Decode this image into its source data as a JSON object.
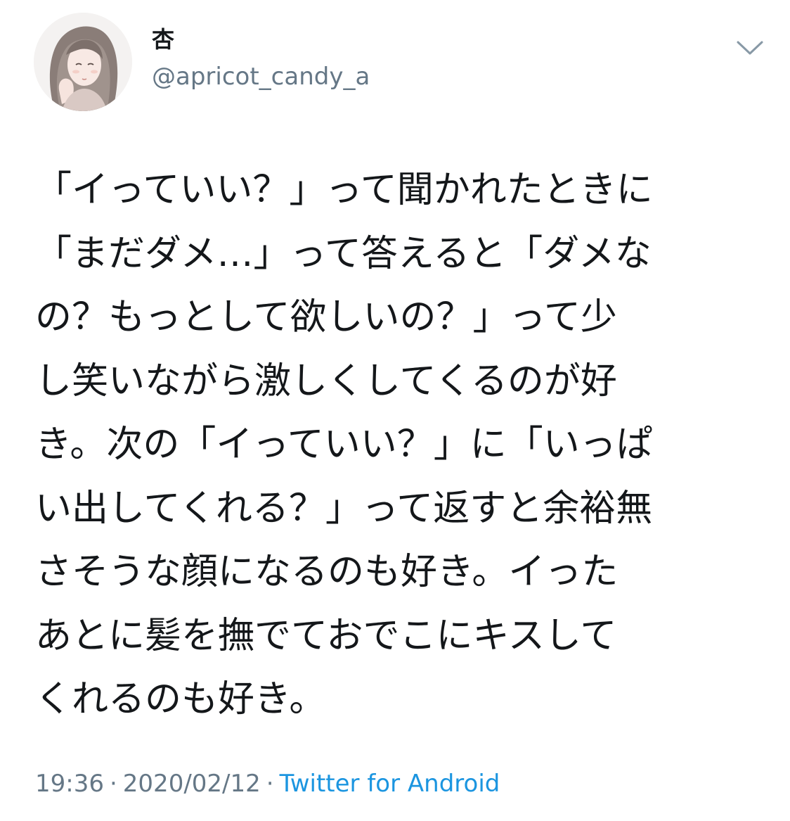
{
  "author": {
    "display_name": "杏",
    "handle": "@apricot_candy_a",
    "avatar_icon": "profile-avatar-illustration"
  },
  "menu_icon": "chevron-down-icon",
  "tweet": {
    "lines": [
      "「イっていい？」って聞かれたときに",
      "「まだダメ…」って答えると「ダメな",
      "の？もっとして欲しいの？」って少",
      "し笑いながら激しくしてくるのが好",
      "き。次の「イっていい？」に「いっぱ",
      "い出してくれる？」って返すと余裕無",
      "さそうな顔になるのも好き。イった",
      "あとに髪を撫でておでこにキスして",
      "くれるのも好き。"
    ]
  },
  "meta": {
    "time": "19:36",
    "date": "2020/02/12",
    "separator": "·",
    "source": "Twitter for Android"
  },
  "colors": {
    "text": "#14171a",
    "secondary": "#657786",
    "link": "#1b95e0"
  }
}
